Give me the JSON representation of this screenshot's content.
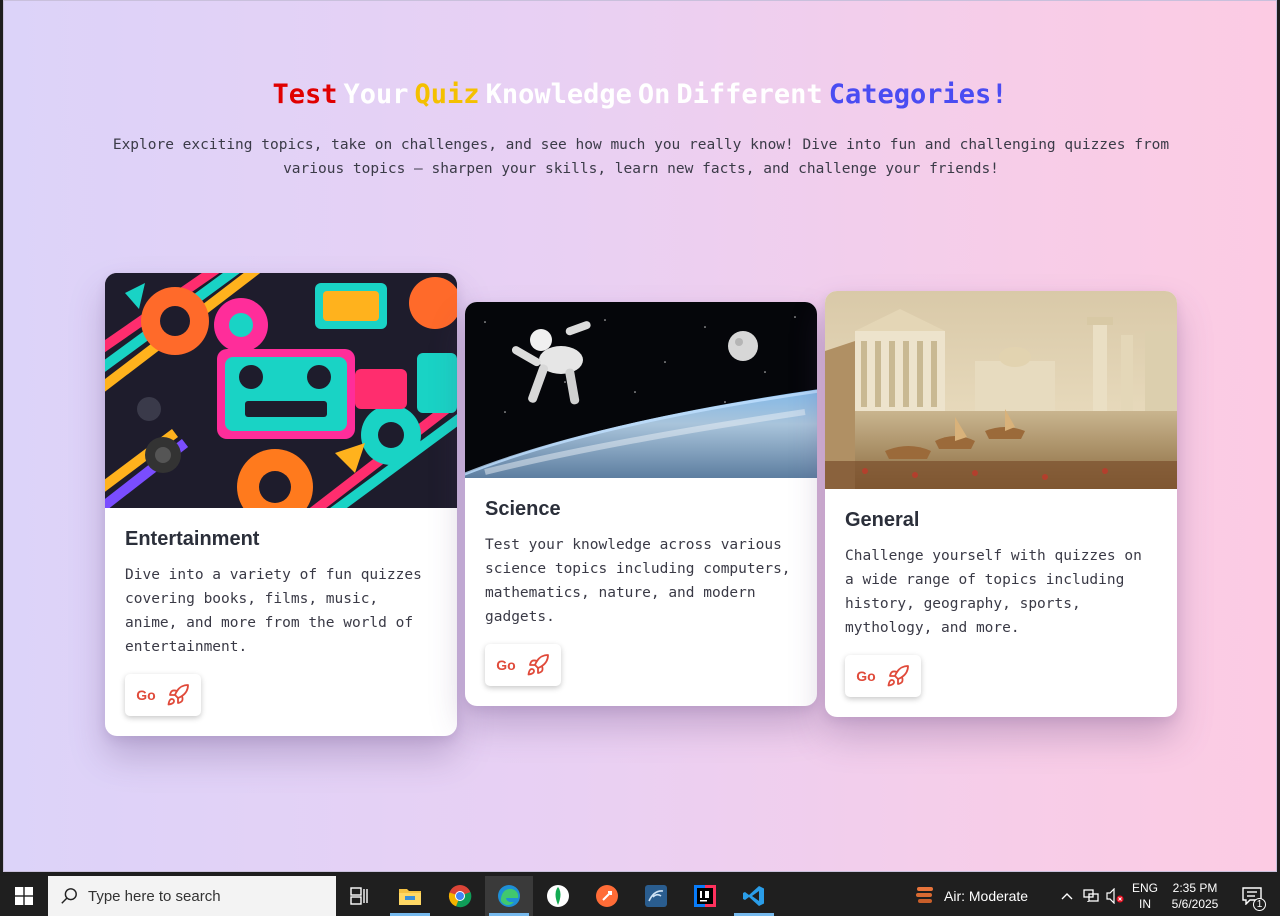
{
  "hero": {
    "title_words": [
      {
        "text": "Test",
        "color": "#e00000"
      },
      {
        "text": "Your",
        "color": "#ffffff"
      },
      {
        "text": "Quiz",
        "color": "#f4c000"
      },
      {
        "text": "Knowledge",
        "color": "#ffffff"
      },
      {
        "text": "On",
        "color": "#ffffff"
      },
      {
        "text": "Different",
        "color": "#ffffff"
      },
      {
        "text": "Categories!",
        "color": "#4a4cf2"
      }
    ],
    "subtitle": "Explore exciting topics, take on challenges, and see how much you really know! Dive into fun and challenging quizzes from various topics — sharpen your skills, learn new facts, and challenge your friends!"
  },
  "cards": [
    {
      "title": "Entertainment",
      "description": "Dive into a variety of fun quizzes covering books, films, music, anime, and more from the world of entertainment.",
      "button_label": "Go",
      "button_icon": "rocket-icon",
      "image": "retro-pop-art-cassette"
    },
    {
      "title": "Science",
      "description": "Test your knowledge across various science topics including computers, mathematics, nature, and modern gadgets.",
      "button_label": "Go",
      "button_icon": "rocket-icon",
      "image": "astronaut-over-earth"
    },
    {
      "title": "General",
      "description": "Challenge yourself with quizzes on a wide range of topics including history, geography, sports, mythology, and more.",
      "button_label": "Go",
      "button_icon": "rocket-icon",
      "image": "classical-city-painting"
    }
  ],
  "taskbar": {
    "search_placeholder": "Type here to search",
    "weather": "Air: Moderate",
    "lang_top": "ENG",
    "lang_bottom": "IN",
    "time": "2:35 PM",
    "date": "5/6/2025",
    "notification_count": "1"
  },
  "colors": {
    "accent_red": "#e04a3a",
    "bg_left": "#dcd3f9",
    "bg_right": "#fccbe3"
  }
}
